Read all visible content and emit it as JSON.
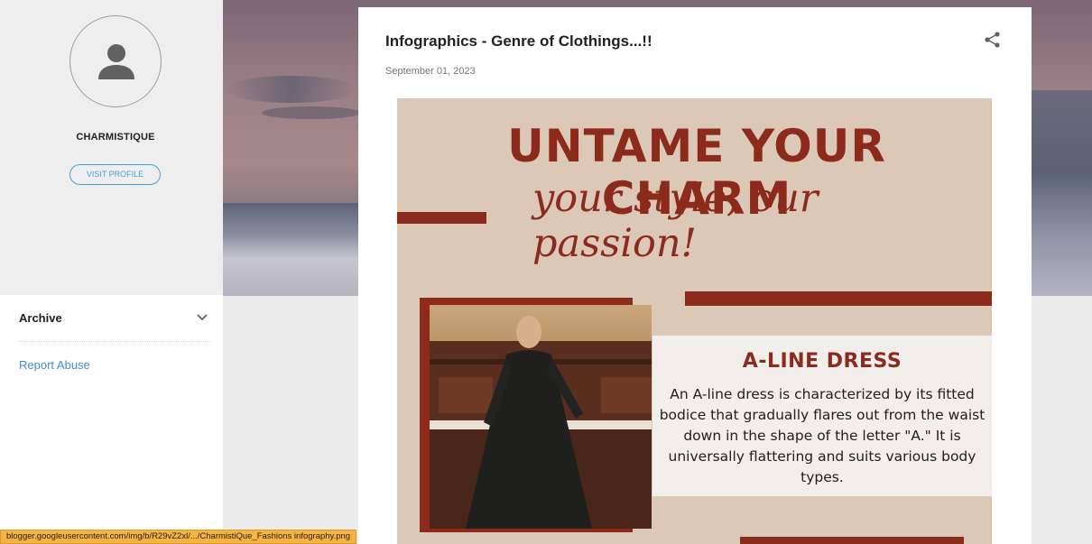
{
  "profile": {
    "name": "CHARMISTIQUE",
    "visit_label": "VISIT PROFILE"
  },
  "sidebar": {
    "archive_label": "Archive",
    "report_label": "Report Abuse"
  },
  "post": {
    "title": "Infographics - Genre of Clothings...!!",
    "date": "September 01, 2023"
  },
  "infographic": {
    "headline": "UNTAME YOUR CHARM",
    "tagline": "your style, our passion!",
    "card_title": "A-LINE DRESS",
    "card_body": "An A-line dress is characterized by its fitted bodice that gradually flares out from the waist down in the shape of the letter \"A.\" It is universally flattering and suits various body types."
  },
  "status_bar": {
    "url": "blogger.googleusercontent.com/img/b/R29vZ2xl/.../CharmistiQue_Fashions infography.png"
  },
  "icons": {
    "avatar": "person-icon",
    "archive": "chevron-down-icon",
    "share": "share-icon"
  },
  "colors": {
    "accent": "#4a9fd8",
    "brand_red": "#8c2a1c",
    "infographic_bg": "#dcc8b6",
    "status_bg": "#f7b340"
  }
}
